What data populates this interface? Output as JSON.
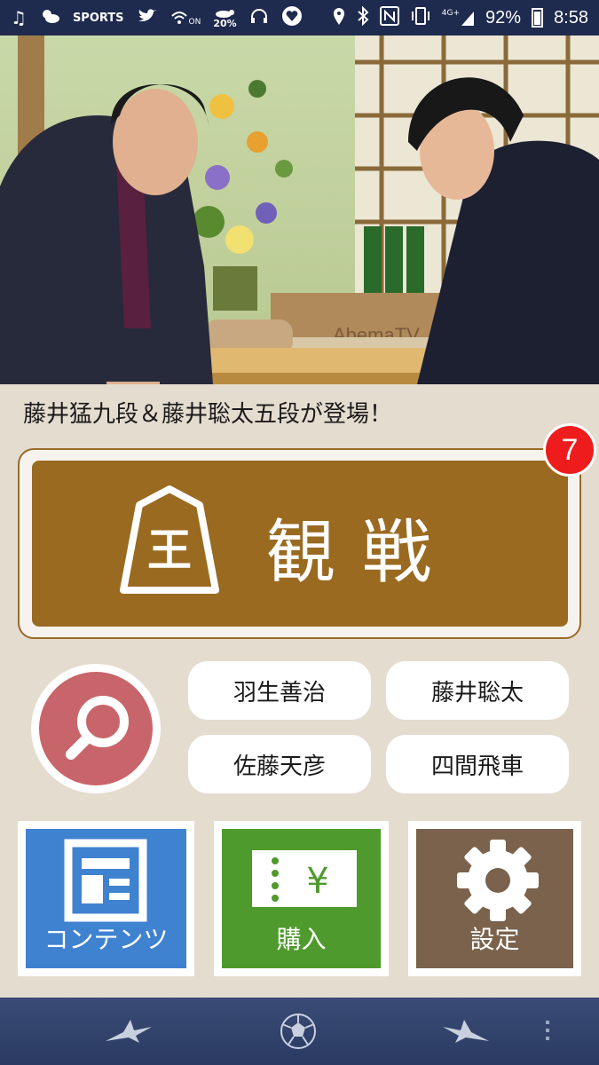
{
  "status_bar": {
    "left_icons": [
      "music-icon",
      "weather-icon",
      "sports-app-icon",
      "twitter-icon",
      "wifi-call-icon",
      "weather-percent-icon",
      "headphones-icon",
      "heart-app-icon"
    ],
    "sports_app_text": "SPORTS",
    "wifi_call_text": "ON",
    "weather_percent": "20%",
    "network": "4G+",
    "battery": "92%",
    "time": "8:58"
  },
  "banner": {
    "headline": "藤井猛九段＆藤井聡太五段が登場！",
    "studio_logo_text": "AbemaTV"
  },
  "watch": {
    "label": "観戦",
    "koma_char": "王",
    "badge_count": "7"
  },
  "search": {
    "tags": [
      "羽生善治",
      "藤井聡太",
      "佐藤天彦",
      "四間飛車"
    ]
  },
  "tiles": [
    {
      "label": "コンテンツ",
      "color": "#3f82d0",
      "icon": "document-icon"
    },
    {
      "label": "購入",
      "color": "#4e9a2c",
      "icon": "ticket-icon",
      "icon_text": "¥"
    },
    {
      "label": "設定",
      "color": "#7a624c",
      "icon": "gear-icon"
    }
  ],
  "navbar": {
    "items": [
      "bird-left-icon",
      "soccer-ball-icon",
      "bird-right-icon"
    ]
  },
  "colors": {
    "background": "#e4dccf",
    "watch_brown": "#9a6a20",
    "badge_red": "#ee1c1c",
    "search_red": "#c8656a",
    "statusbar": "#1e2a4e"
  }
}
